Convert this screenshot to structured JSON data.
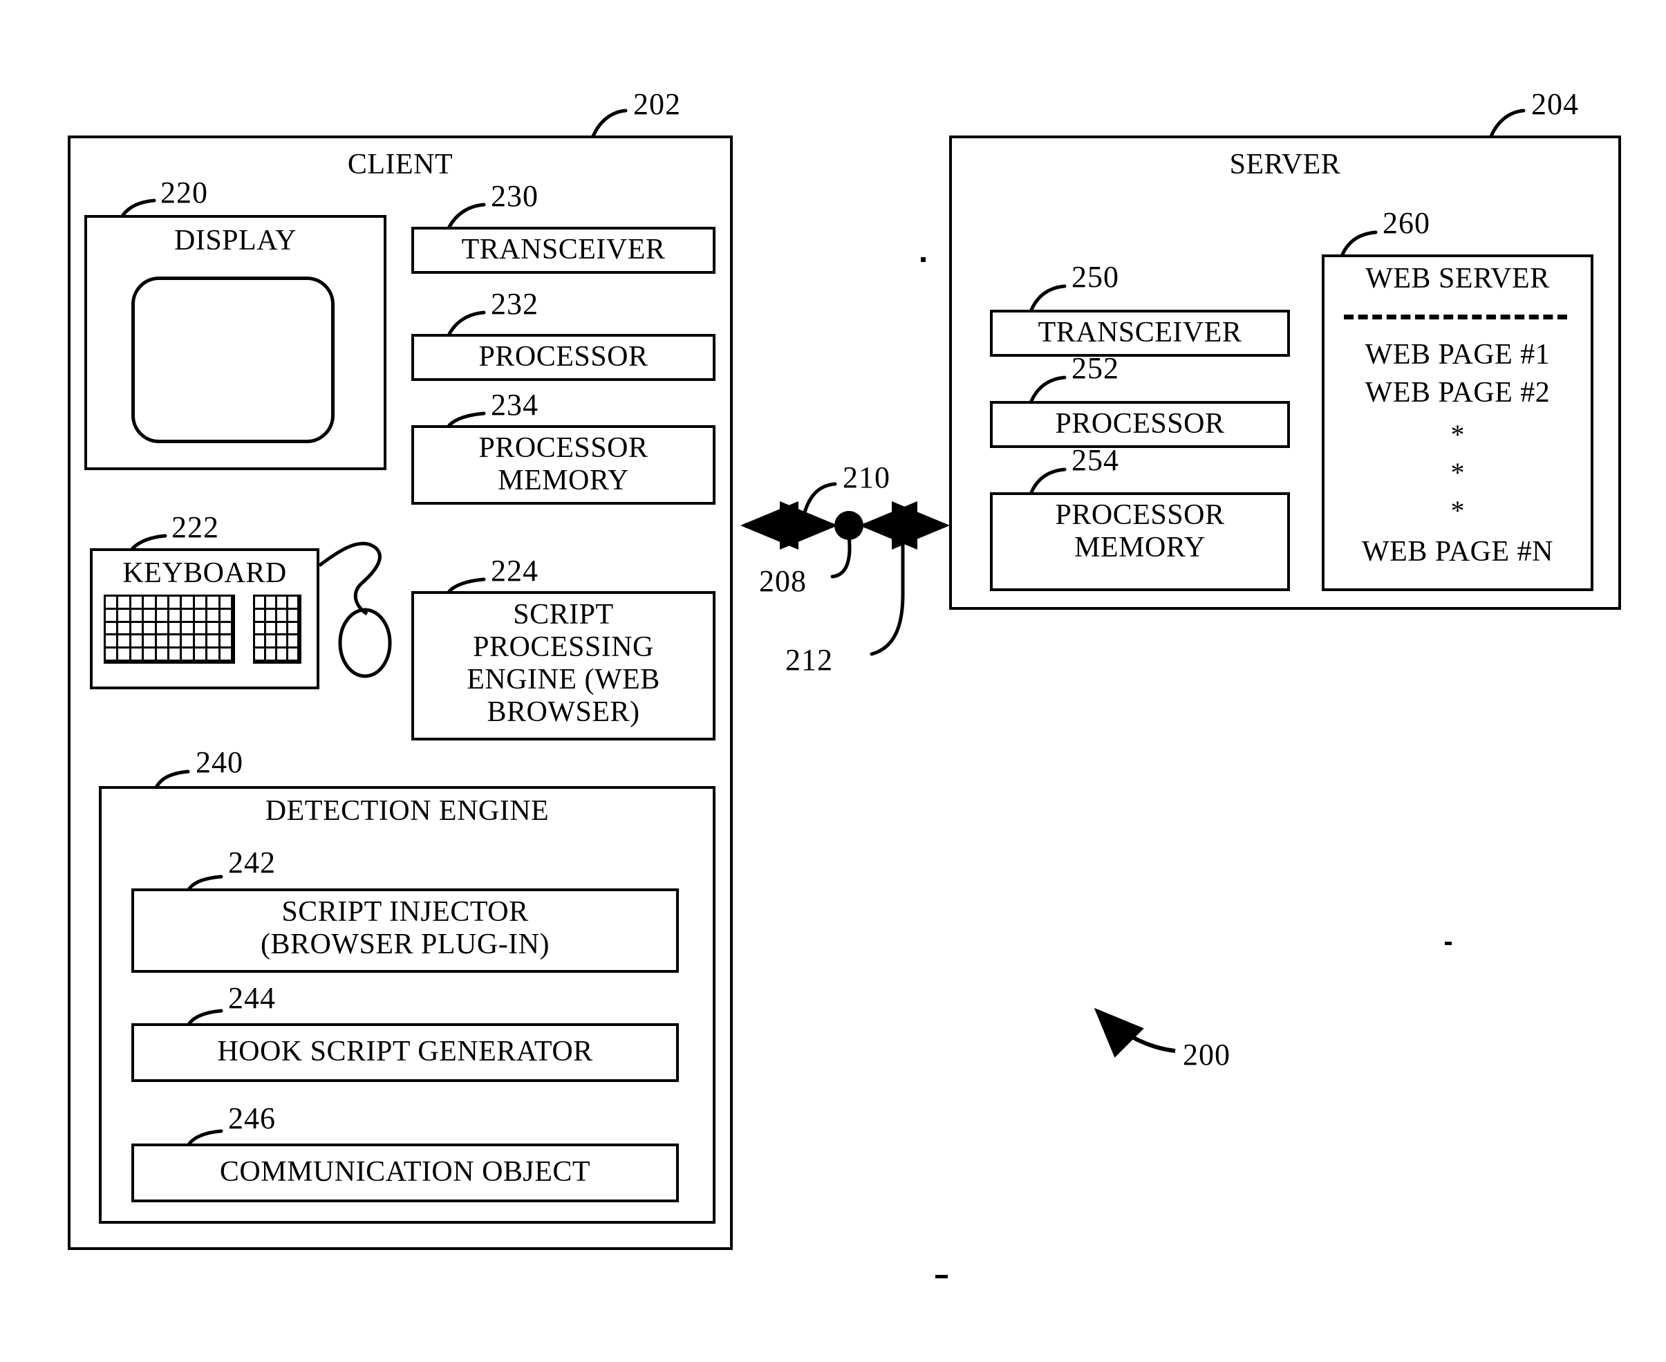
{
  "figure": {
    "system_ref": "200"
  },
  "client": {
    "ref": "202",
    "title": "CLIENT",
    "display": {
      "ref": "220",
      "label": "DISPLAY"
    },
    "keyboard": {
      "ref": "222",
      "label": "KEYBOARD",
      "main_keys_cols": 10,
      "main_keys_rows": 5,
      "pad_keys_cols": 4,
      "pad_keys_rows": 5
    },
    "transceiver": {
      "ref": "230",
      "label": "TRANSCEIVER"
    },
    "processor": {
      "ref": "232",
      "label": "PROCESSOR"
    },
    "processor_memory": {
      "ref": "234",
      "label": "PROCESSOR\nMEMORY"
    },
    "script_engine": {
      "ref": "224",
      "label": "SCRIPT\nPROCESSING\nENGINE (WEB\nBROWSER)"
    },
    "detection_engine": {
      "ref": "240",
      "label": "DETECTION ENGINE",
      "components": [
        {
          "ref": "242",
          "label": "SCRIPT INJECTOR\n(BROWSER PLUG-IN)"
        },
        {
          "ref": "244",
          "label": "HOOK SCRIPT GENERATOR"
        },
        {
          "ref": "246",
          "label": "COMMUNICATION OBJECT"
        }
      ]
    }
  },
  "network": {
    "link_ref": "208",
    "node_ref": "210",
    "path_ref": "212"
  },
  "server": {
    "ref": "204",
    "title": "SERVER",
    "transceiver": {
      "ref": "250",
      "label": "TRANSCEIVER"
    },
    "processor": {
      "ref": "252",
      "label": "PROCESSOR"
    },
    "processor_memory": {
      "ref": "254",
      "label": "PROCESSOR\nMEMORY"
    },
    "web_server": {
      "ref": "260",
      "label": "WEB SERVER",
      "pages": [
        "WEB PAGE #1",
        "WEB PAGE #2"
      ],
      "ellipsis": [
        "*",
        "*",
        "*"
      ],
      "last_page": "WEB PAGE #N"
    }
  },
  "colors": {
    "ink": "#000000",
    "paper": "#ffffff"
  }
}
